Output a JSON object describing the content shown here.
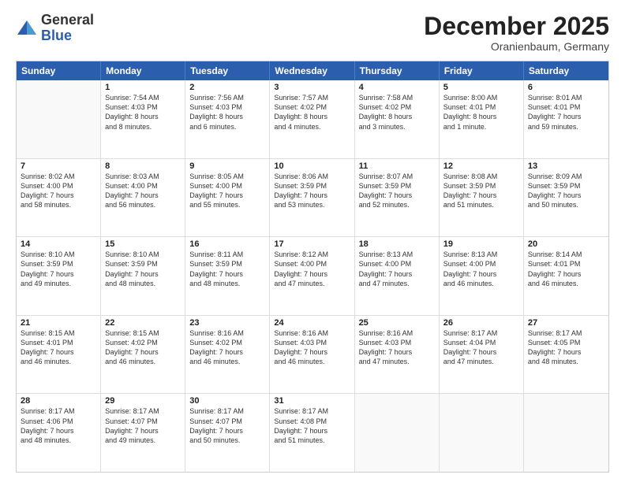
{
  "header": {
    "logo_general": "General",
    "logo_blue": "Blue",
    "month_title": "December 2025",
    "subtitle": "Oranienbaum, Germany"
  },
  "days_of_week": [
    "Sunday",
    "Monday",
    "Tuesday",
    "Wednesday",
    "Thursday",
    "Friday",
    "Saturday"
  ],
  "weeks": [
    [
      {
        "day": "",
        "lines": []
      },
      {
        "day": "1",
        "lines": [
          "Sunrise: 7:54 AM",
          "Sunset: 4:03 PM",
          "Daylight: 8 hours",
          "and 8 minutes."
        ]
      },
      {
        "day": "2",
        "lines": [
          "Sunrise: 7:56 AM",
          "Sunset: 4:03 PM",
          "Daylight: 8 hours",
          "and 6 minutes."
        ]
      },
      {
        "day": "3",
        "lines": [
          "Sunrise: 7:57 AM",
          "Sunset: 4:02 PM",
          "Daylight: 8 hours",
          "and 4 minutes."
        ]
      },
      {
        "day": "4",
        "lines": [
          "Sunrise: 7:58 AM",
          "Sunset: 4:02 PM",
          "Daylight: 8 hours",
          "and 3 minutes."
        ]
      },
      {
        "day": "5",
        "lines": [
          "Sunrise: 8:00 AM",
          "Sunset: 4:01 PM",
          "Daylight: 8 hours",
          "and 1 minute."
        ]
      },
      {
        "day": "6",
        "lines": [
          "Sunrise: 8:01 AM",
          "Sunset: 4:01 PM",
          "Daylight: 7 hours",
          "and 59 minutes."
        ]
      }
    ],
    [
      {
        "day": "7",
        "lines": [
          "Sunrise: 8:02 AM",
          "Sunset: 4:00 PM",
          "Daylight: 7 hours",
          "and 58 minutes."
        ]
      },
      {
        "day": "8",
        "lines": [
          "Sunrise: 8:03 AM",
          "Sunset: 4:00 PM",
          "Daylight: 7 hours",
          "and 56 minutes."
        ]
      },
      {
        "day": "9",
        "lines": [
          "Sunrise: 8:05 AM",
          "Sunset: 4:00 PM",
          "Daylight: 7 hours",
          "and 55 minutes."
        ]
      },
      {
        "day": "10",
        "lines": [
          "Sunrise: 8:06 AM",
          "Sunset: 3:59 PM",
          "Daylight: 7 hours",
          "and 53 minutes."
        ]
      },
      {
        "day": "11",
        "lines": [
          "Sunrise: 8:07 AM",
          "Sunset: 3:59 PM",
          "Daylight: 7 hours",
          "and 52 minutes."
        ]
      },
      {
        "day": "12",
        "lines": [
          "Sunrise: 8:08 AM",
          "Sunset: 3:59 PM",
          "Daylight: 7 hours",
          "and 51 minutes."
        ]
      },
      {
        "day": "13",
        "lines": [
          "Sunrise: 8:09 AM",
          "Sunset: 3:59 PM",
          "Daylight: 7 hours",
          "and 50 minutes."
        ]
      }
    ],
    [
      {
        "day": "14",
        "lines": [
          "Sunrise: 8:10 AM",
          "Sunset: 3:59 PM",
          "Daylight: 7 hours",
          "and 49 minutes."
        ]
      },
      {
        "day": "15",
        "lines": [
          "Sunrise: 8:10 AM",
          "Sunset: 3:59 PM",
          "Daylight: 7 hours",
          "and 48 minutes."
        ]
      },
      {
        "day": "16",
        "lines": [
          "Sunrise: 8:11 AM",
          "Sunset: 3:59 PM",
          "Daylight: 7 hours",
          "and 48 minutes."
        ]
      },
      {
        "day": "17",
        "lines": [
          "Sunrise: 8:12 AM",
          "Sunset: 4:00 PM",
          "Daylight: 7 hours",
          "and 47 minutes."
        ]
      },
      {
        "day": "18",
        "lines": [
          "Sunrise: 8:13 AM",
          "Sunset: 4:00 PM",
          "Daylight: 7 hours",
          "and 47 minutes."
        ]
      },
      {
        "day": "19",
        "lines": [
          "Sunrise: 8:13 AM",
          "Sunset: 4:00 PM",
          "Daylight: 7 hours",
          "and 46 minutes."
        ]
      },
      {
        "day": "20",
        "lines": [
          "Sunrise: 8:14 AM",
          "Sunset: 4:01 PM",
          "Daylight: 7 hours",
          "and 46 minutes."
        ]
      }
    ],
    [
      {
        "day": "21",
        "lines": [
          "Sunrise: 8:15 AM",
          "Sunset: 4:01 PM",
          "Daylight: 7 hours",
          "and 46 minutes."
        ]
      },
      {
        "day": "22",
        "lines": [
          "Sunrise: 8:15 AM",
          "Sunset: 4:02 PM",
          "Daylight: 7 hours",
          "and 46 minutes."
        ]
      },
      {
        "day": "23",
        "lines": [
          "Sunrise: 8:16 AM",
          "Sunset: 4:02 PM",
          "Daylight: 7 hours",
          "and 46 minutes."
        ]
      },
      {
        "day": "24",
        "lines": [
          "Sunrise: 8:16 AM",
          "Sunset: 4:03 PM",
          "Daylight: 7 hours",
          "and 46 minutes."
        ]
      },
      {
        "day": "25",
        "lines": [
          "Sunrise: 8:16 AM",
          "Sunset: 4:03 PM",
          "Daylight: 7 hours",
          "and 47 minutes."
        ]
      },
      {
        "day": "26",
        "lines": [
          "Sunrise: 8:17 AM",
          "Sunset: 4:04 PM",
          "Daylight: 7 hours",
          "and 47 minutes."
        ]
      },
      {
        "day": "27",
        "lines": [
          "Sunrise: 8:17 AM",
          "Sunset: 4:05 PM",
          "Daylight: 7 hours",
          "and 48 minutes."
        ]
      }
    ],
    [
      {
        "day": "28",
        "lines": [
          "Sunrise: 8:17 AM",
          "Sunset: 4:06 PM",
          "Daylight: 7 hours",
          "and 48 minutes."
        ]
      },
      {
        "day": "29",
        "lines": [
          "Sunrise: 8:17 AM",
          "Sunset: 4:07 PM",
          "Daylight: 7 hours",
          "and 49 minutes."
        ]
      },
      {
        "day": "30",
        "lines": [
          "Sunrise: 8:17 AM",
          "Sunset: 4:07 PM",
          "Daylight: 7 hours",
          "and 50 minutes."
        ]
      },
      {
        "day": "31",
        "lines": [
          "Sunrise: 8:17 AM",
          "Sunset: 4:08 PM",
          "Daylight: 7 hours",
          "and 51 minutes."
        ]
      },
      {
        "day": "",
        "lines": []
      },
      {
        "day": "",
        "lines": []
      },
      {
        "day": "",
        "lines": []
      }
    ]
  ]
}
